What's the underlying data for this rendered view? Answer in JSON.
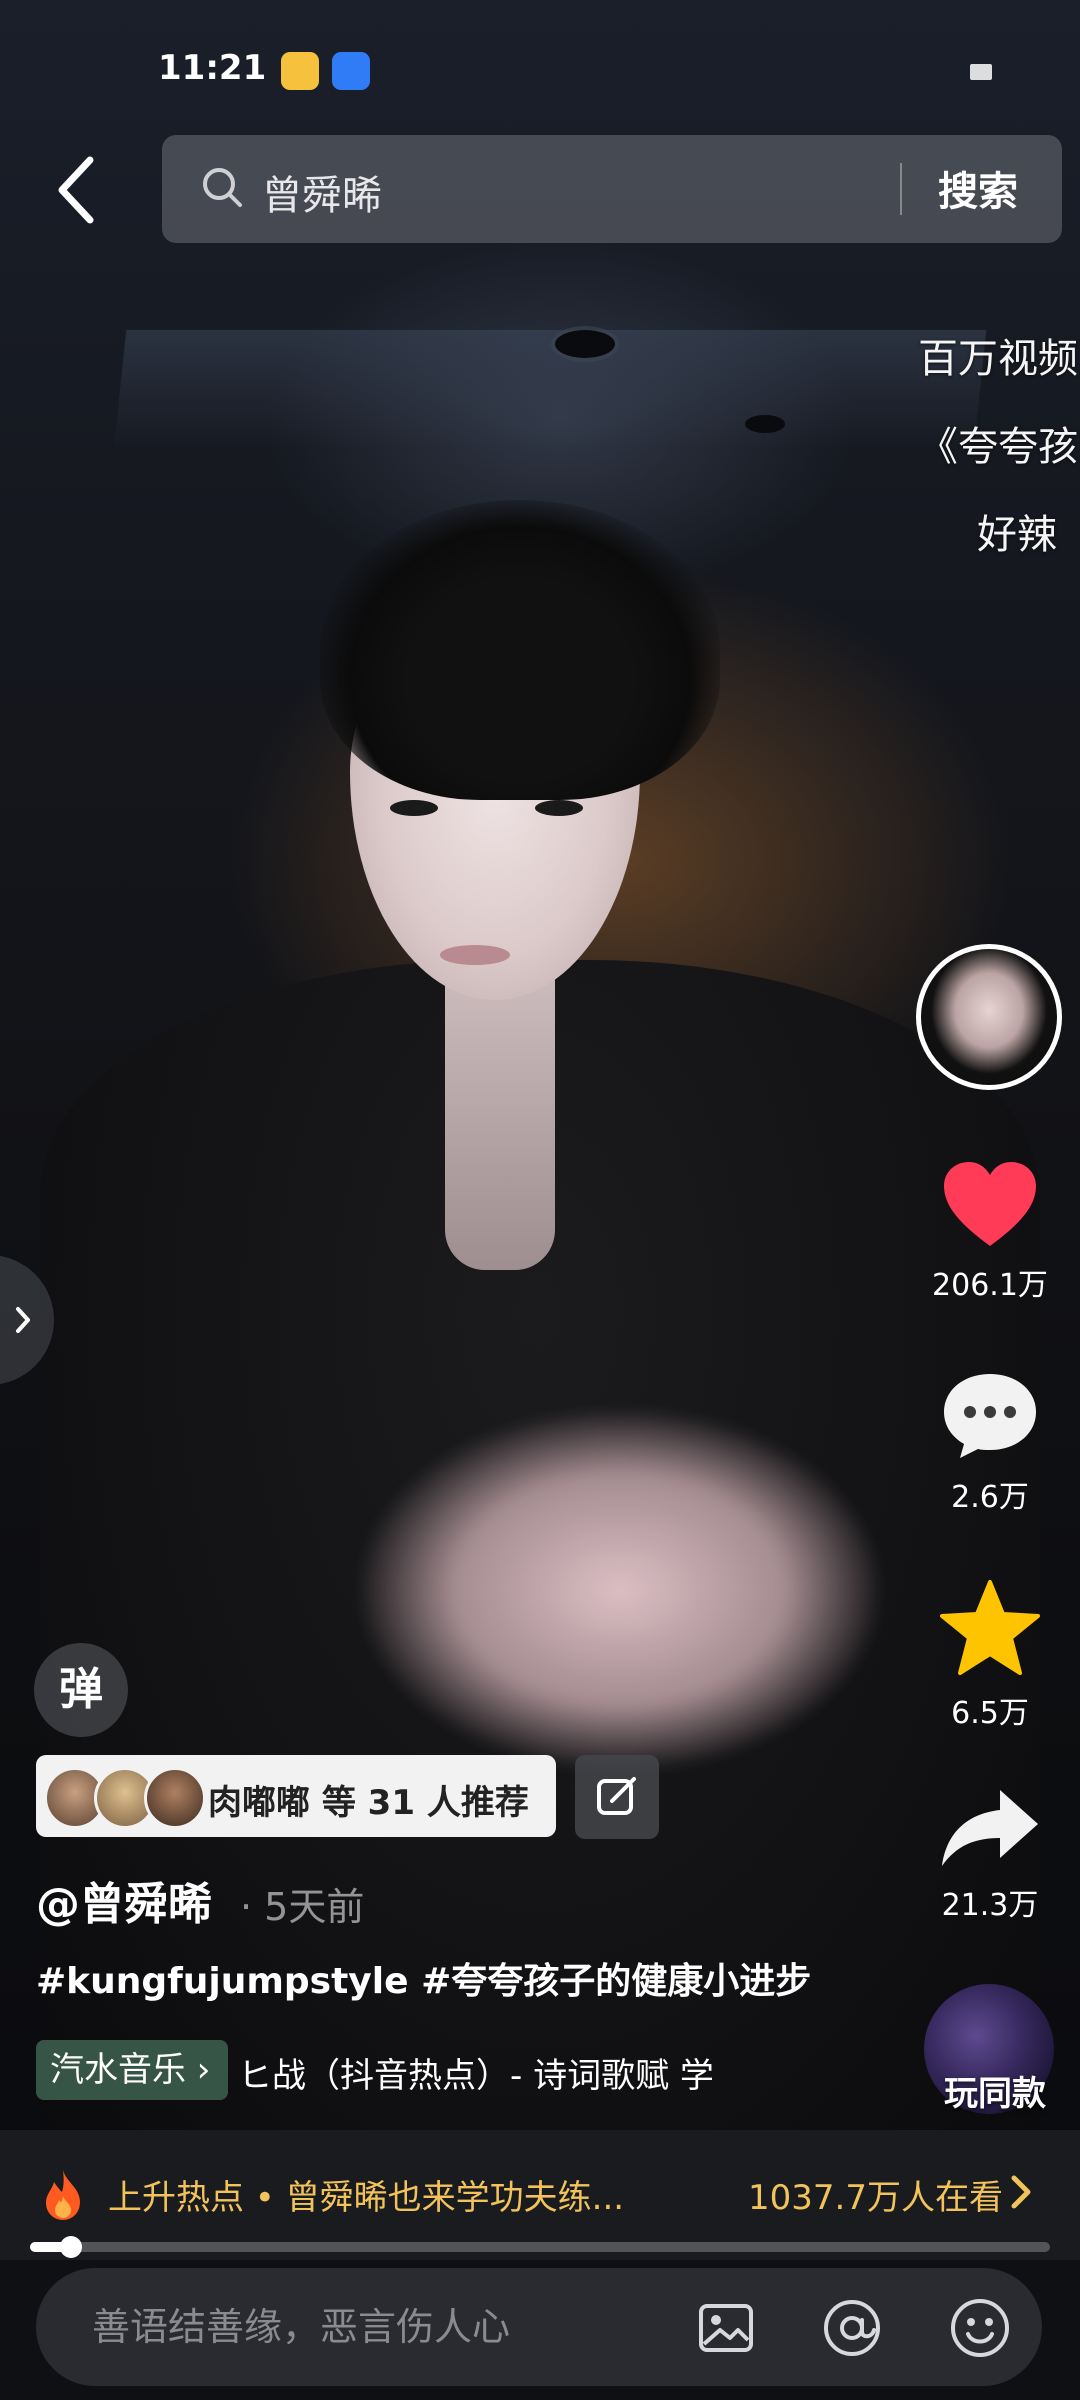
{
  "status_bar": {
    "time": "11:21"
  },
  "search": {
    "query": "曾舜晞",
    "button": "搜索"
  },
  "overlay_text": [
    "百万视频",
    "《夸夸孩",
    "好辣"
  ],
  "actions": {
    "like_count": "206.1万",
    "comment_count": "2.6万",
    "favorite_count": "6.5万",
    "share_count": "21.3万",
    "play_same_label": "玩同款"
  },
  "danmaku_label": "弹",
  "recommend": {
    "text": "肉嘟嘟 等 31 人推荐"
  },
  "post": {
    "author": "@曾舜晞",
    "time": "· 5天前",
    "caption": "#kungfujumpstyle #夸夸孩子的健康小进步"
  },
  "music": {
    "chip": "汽水音乐 ›",
    "text": "ヒ战（抖音热点）- 诗词歌赋   学"
  },
  "hot": {
    "text": "上升热点 • 曾舜晞也来学功夫练...",
    "viewers": "1037.7万人在看"
  },
  "progress": {
    "fraction": 0.04
  },
  "comment": {
    "placeholder": "善语结善缘，恶言伤人心"
  },
  "colors": {
    "like": "#ff3b57",
    "favorite": "#ffc400",
    "hot_text": "#f2c35a"
  }
}
